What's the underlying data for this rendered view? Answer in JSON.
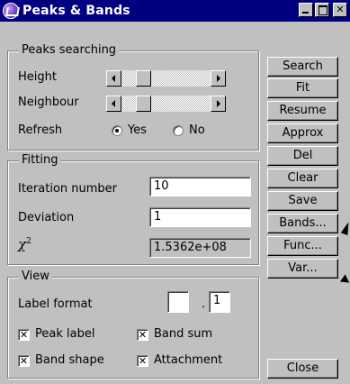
{
  "window": {
    "title": "Peaks & Bands"
  },
  "peaks_searching": {
    "label": "Peaks searching",
    "height_label": "Height",
    "neighbour_label": "Neighbour",
    "refresh_label": "Refresh",
    "refresh_yes": "Yes",
    "refresh_no": "No",
    "refresh_selected": "Yes"
  },
  "fitting": {
    "label": "Fitting",
    "iteration_label": "Iteration number",
    "iteration_value": "10",
    "deviation_label": "Deviation",
    "deviation_value": "1",
    "chi_label": "χ",
    "chi_sup": "2",
    "chi_value": "1.5362e+08"
  },
  "view": {
    "label": "View",
    "label_format_label": "Label format",
    "label_format_int": "",
    "label_format_sep": ".",
    "label_format_dec": "1",
    "peak_label": "Peak label",
    "band_sum": "Band sum",
    "band_shape": "Band shape",
    "attachment": "Attachment",
    "check_mark": "✕"
  },
  "buttons": {
    "search": "Search",
    "fit": "Fit",
    "resume": "Resume",
    "approx": "Approx",
    "del": "Del",
    "clear": "Clear",
    "save": "Save",
    "bands": "Bands...",
    "func": "Func...",
    "var": "Var...",
    "close": "Close"
  },
  "icons": {
    "app": "peaks-app-icon",
    "minimize": "minimize-icon",
    "maximize": "maximize-icon",
    "close": "close-icon"
  }
}
